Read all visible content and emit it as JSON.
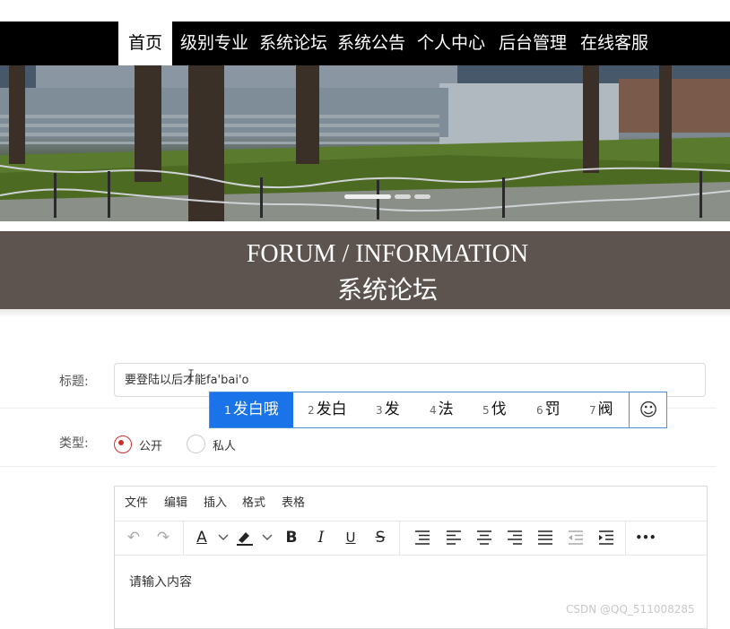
{
  "nav": {
    "items": [
      "首页",
      "级别专业",
      "系统论坛",
      "系统公告",
      "个人中心",
      "后台管理",
      "在线客服"
    ],
    "active_index": 0
  },
  "carousel": {
    "slides": 3,
    "active_index": 0
  },
  "hero": {
    "en": "FORUM / INFORMATION",
    "cn": "系统论坛"
  },
  "form": {
    "title_label": "标题:",
    "title_value": "要登陆以后才能fa'bai'o",
    "type_label": "类型:",
    "type_options": [
      "公开",
      "私人"
    ],
    "type_selected": "公开"
  },
  "ime": {
    "candidates": [
      {
        "n": "1",
        "text": "发白哦"
      },
      {
        "n": "2",
        "text": "发白"
      },
      {
        "n": "3",
        "text": "发"
      },
      {
        "n": "4",
        "text": "法"
      },
      {
        "n": "5",
        "text": "伐"
      },
      {
        "n": "6",
        "text": "罚"
      },
      {
        "n": "7",
        "text": "阀"
      }
    ],
    "selected_index": 0,
    "emoji_icon": "smiley-icon"
  },
  "editor": {
    "menus": [
      "文件",
      "编辑",
      "插入",
      "格式",
      "表格"
    ],
    "placeholder": "请输入内容",
    "tools": {
      "undo": "↶",
      "redo": "↷",
      "font_color": "A",
      "bold": "B",
      "italic": "I",
      "underline": "U",
      "strike": "S",
      "more": "•••"
    }
  },
  "watermark": "CSDN @QQ_511008285",
  "colors": {
    "nav_bg": "#000000",
    "hero_bg": "#5d5450",
    "ime_selected": "#1a73e8",
    "radio_checked": "#c9302c"
  }
}
